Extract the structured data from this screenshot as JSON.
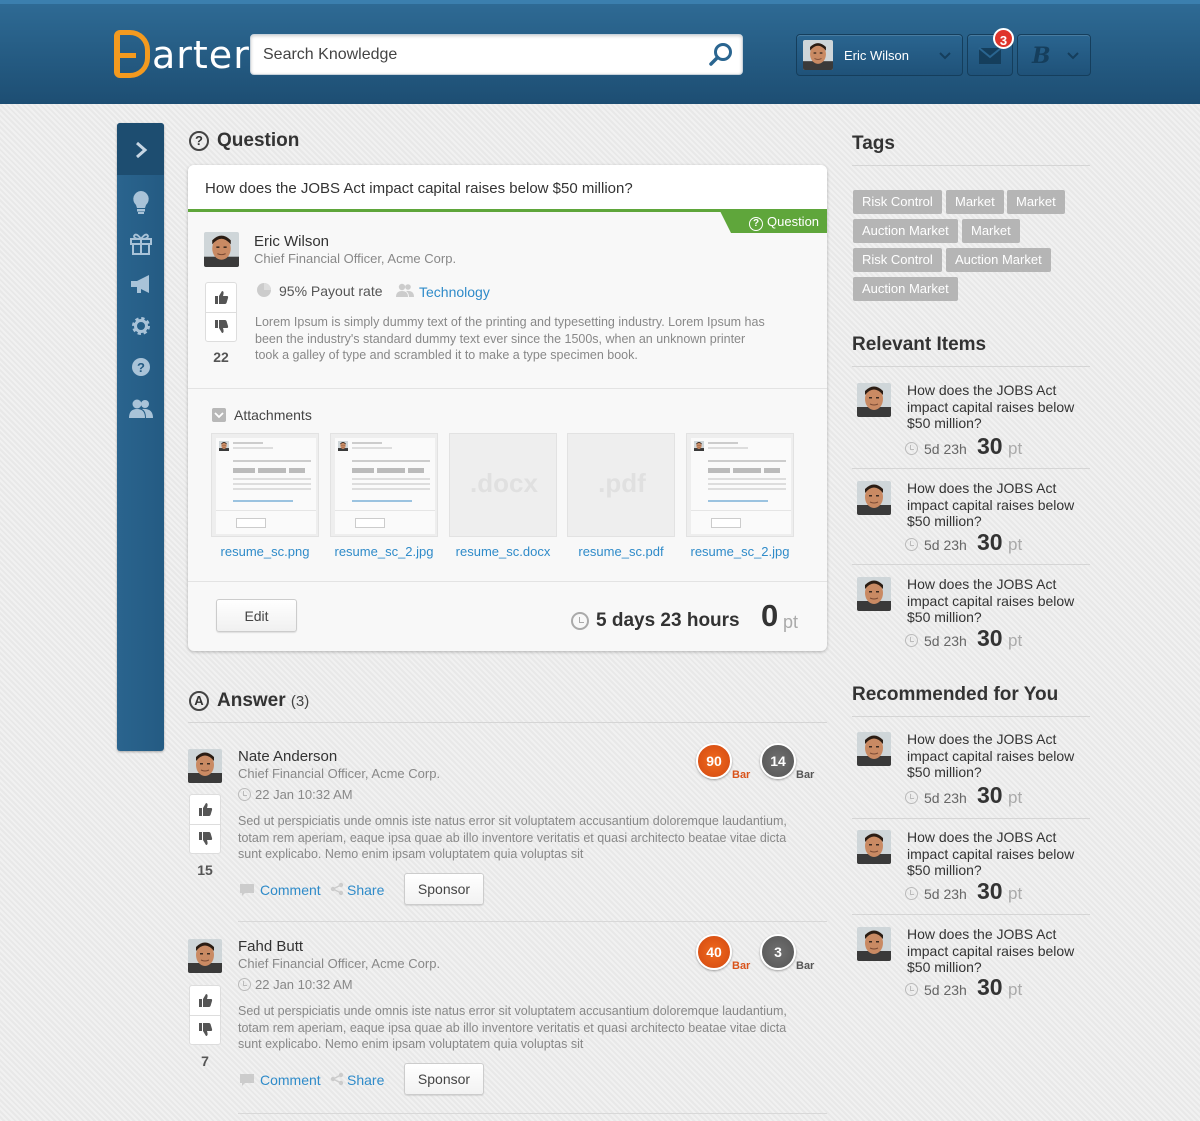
{
  "header": {
    "logo_text": "arter",
    "logo_letter": "B",
    "search_placeholder": "Search Knowledge",
    "user_name": "Eric Wilson",
    "mail_count": "3",
    "b_label": "B"
  },
  "sidebar": {
    "icons": [
      "chevron-right-icon",
      "lightbulb-icon",
      "gift-icon",
      "megaphone-icon",
      "gear-icon",
      "help-icon",
      "users-icon"
    ]
  },
  "question_section": {
    "title": "Question",
    "question_text": "How does the JOBS Act impact capital raises below $50 million?",
    "tag_label": "Question",
    "author_name": "Eric Wilson",
    "author_role": "Chief Financial Officer, Acme Corp.",
    "votes": "22",
    "payout": "95% Payout rate",
    "category": "Technology",
    "body_lines": [
      "Lorem Ipsum is simply dummy text of the printing and typesetting industry. Lorem Ipsum has",
      "been the industry's standard dummy text ever since the 1500s, when an unknown printer",
      "took a galley of type and scrambled it to make a type specimen book."
    ],
    "attachments_title": "Attachments",
    "attachments": [
      {
        "name": "resume_sc.png",
        "kind": "image",
        "ext": ""
      },
      {
        "name": "resume_sc_2.jpg",
        "kind": "image",
        "ext": ""
      },
      {
        "name": "resume_sc.docx",
        "kind": "doc",
        "ext": ".docx"
      },
      {
        "name": "resume_sc.pdf",
        "kind": "doc",
        "ext": ".pdf"
      },
      {
        "name": "resume_sc_2.jpg",
        "kind": "image",
        "ext": ""
      }
    ],
    "edit_label": "Edit",
    "time_left": "5 days 23 hours",
    "points": "0",
    "points_unit": "pt"
  },
  "answer_section": {
    "title": "Answer",
    "count": "(3)",
    "answers": [
      {
        "name": "Nate Anderson",
        "role": "Chief Financial Officer, Acme Corp.",
        "date": "22 Jan 10:32 AM",
        "votes": "15",
        "badge1": "90",
        "badge1_label": "Bar",
        "badge2": "14",
        "badge2_label": "Bar",
        "body_lines": [
          "Sed ut perspiciatis unde omnis iste natus error sit voluptatem accusantium doloremque laudantium,",
          "totam rem aperiam, eaque ipsa quae ab illo inventore veritatis et quasi architecto beatae vitae dicta",
          "sunt explicabo. Nemo enim ipsam voluptatem quia voluptas sit"
        ],
        "comment_label": "Comment",
        "share_label": "Share",
        "sponsor_label": "Sponsor"
      },
      {
        "name": "Fahd Butt",
        "role": "Chief Financial Officer, Acme Corp.",
        "date": "22 Jan 10:32 AM",
        "votes": "7",
        "badge1": "40",
        "badge1_label": "Bar",
        "badge2": "3",
        "badge2_label": "Bar",
        "body_lines": [
          "Sed ut perspiciatis unde omnis iste natus error sit voluptatem accusantium doloremque laudantium,",
          "totam rem aperiam, eaque ipsa quae ab illo inventore veritatis et quasi architecto beatae vitae dicta",
          "sunt explicabo. Nemo enim ipsam voluptatem quia voluptas sit"
        ],
        "comment_label": "Comment",
        "share_label": "Share",
        "sponsor_label": "Sponsor"
      }
    ]
  },
  "tags": {
    "title": "Tags",
    "items": [
      "Risk Control",
      "Market",
      "Market",
      "Auction Market",
      "Market",
      "Risk Control",
      "Auction Market",
      "Auction Market"
    ]
  },
  "relevant": {
    "title": "Relevant Items",
    "items": [
      {
        "lines": [
          "How does the JOBS Act",
          "impact capital raises below",
          "$50 million?"
        ],
        "time": "5d 23h",
        "points": "30",
        "unit": "pt"
      },
      {
        "lines": [
          "How does the JOBS Act",
          "impact capital raises below",
          "$50 million?"
        ],
        "time": "5d 23h",
        "points": "30",
        "unit": "pt"
      },
      {
        "lines": [
          "How does the JOBS Act",
          "impact capital raises below",
          "$50 million?"
        ],
        "time": "5d 23h",
        "points": "30",
        "unit": "pt"
      }
    ]
  },
  "recommended": {
    "title": "Recommended for You",
    "items": [
      {
        "lines": [
          "How does the JOBS Act",
          "impact capital raises below",
          "$50 million?"
        ],
        "time": "5d 23h",
        "points": "30",
        "unit": "pt"
      },
      {
        "lines": [
          "How does the JOBS Act",
          "impact capital raises below",
          "$50 million?"
        ],
        "time": "5d 23h",
        "points": "30",
        "unit": "pt"
      },
      {
        "lines": [
          "How does the JOBS Act",
          "impact capital raises below",
          "$50 million?"
        ],
        "time": "5d 23h",
        "points": "30",
        "unit": "pt"
      }
    ]
  },
  "colors": {
    "header": "#1d4e73",
    "accent_green": "#5fa63b",
    "link_blue": "#2f8bc9",
    "badge_orange": "#e5581a",
    "tag_gray": "#b5b5b5"
  }
}
